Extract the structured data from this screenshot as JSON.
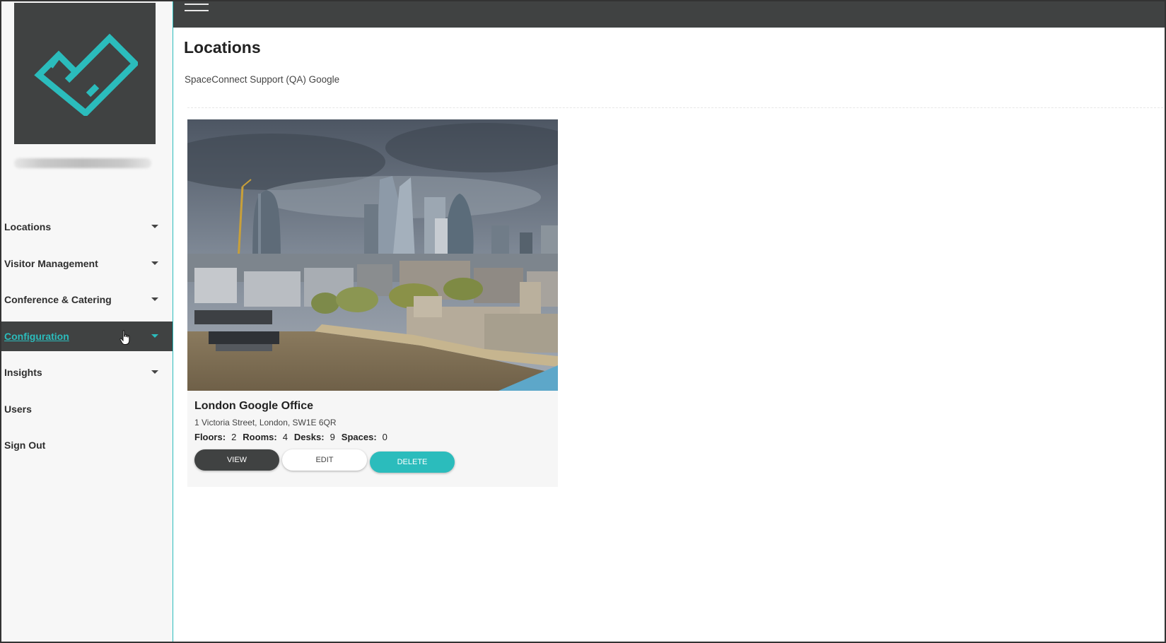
{
  "sidebar": {
    "items": [
      {
        "label": "Locations",
        "has_caret": true
      },
      {
        "label": "Visitor Management",
        "has_caret": true
      },
      {
        "label": "Conference & Catering",
        "has_caret": true
      },
      {
        "label": "Configuration",
        "has_caret": true,
        "active": true
      },
      {
        "label": "Insights",
        "has_caret": true
      },
      {
        "label": "Users",
        "has_caret": false
      },
      {
        "label": "Sign Out",
        "has_caret": false
      }
    ]
  },
  "header": {
    "menu_icon": "hamburger-icon"
  },
  "main": {
    "title": "Locations",
    "subtitle": "SpaceConnect Support (QA) Google"
  },
  "card": {
    "title": "London Google Office",
    "address": "1 Victoria Street, London, SW1E 6QR",
    "stats": {
      "floors_label": "Floors:",
      "floors_value": "2",
      "rooms_label": "Rooms:",
      "rooms_value": "4",
      "desks_label": "Desks:",
      "desks_value": "9",
      "spaces_label": "Spaces:",
      "spaces_value": "0"
    },
    "buttons": {
      "view": "VIEW",
      "edit": "EDIT",
      "delete": "DELETE"
    }
  },
  "colors": {
    "accent": "#2bbcbc",
    "dark": "#404242",
    "sidebar_bg": "#f7f7f7"
  }
}
